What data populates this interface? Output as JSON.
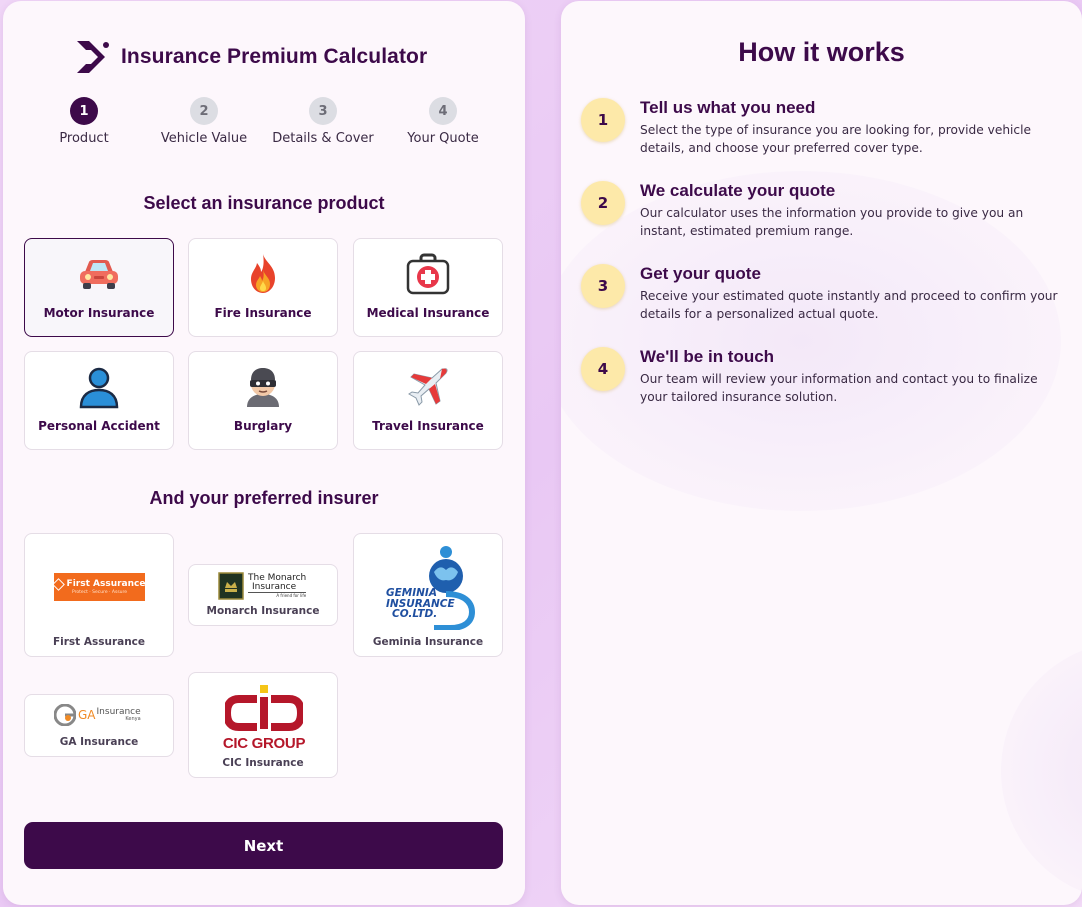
{
  "app": {
    "title": "Insurance Premium Calculator"
  },
  "steps": [
    {
      "number": "1",
      "label": "Product",
      "active": true
    },
    {
      "number": "2",
      "label": "Vehicle Value",
      "active": false
    },
    {
      "number": "3",
      "label": "Details & Cover",
      "active": false
    },
    {
      "number": "4",
      "label": "Your Quote",
      "active": false
    }
  ],
  "products": {
    "title": "Select an insurance product",
    "items": [
      {
        "label": "Motor Insurance",
        "icon": "car-icon",
        "selected": true
      },
      {
        "label": "Fire Insurance",
        "icon": "fire-icon"
      },
      {
        "label": "Medical Insurance",
        "icon": "first-aid-kit-icon"
      },
      {
        "label": "Personal Accident",
        "icon": "person-icon"
      },
      {
        "label": "Burglary",
        "icon": "burglar-icon"
      },
      {
        "label": "Travel Insurance",
        "icon": "airplane-icon"
      }
    ]
  },
  "insurers": {
    "title": "And your preferred insurer",
    "items": [
      {
        "name": "First Assurance",
        "logo_text": "First Assurance",
        "logo_tagline": "Protect · Secure · Assure"
      },
      {
        "name": "Monarch Insurance",
        "logo_text_1": "The Monarch",
        "logo_text_2": "Insurance",
        "logo_tagline": "A friend for life"
      },
      {
        "name": "Geminia Insurance",
        "logo_text_1": "GEMINIA",
        "logo_text_2": "INSURANCE",
        "logo_text_3": "CO.LTD."
      },
      {
        "name": "GA Insurance",
        "logo_text_1": "GA",
        "logo_text_2": "Insurance",
        "logo_text_3": "Kenya"
      },
      {
        "name": "CIC Insurance",
        "logo_text": "CIC GROUP"
      }
    ]
  },
  "next_label": "Next",
  "how_it_works": {
    "title": "How it works",
    "steps": [
      {
        "number": "1",
        "title": "Tell us what you need",
        "body": "Select the type of insurance you are looking for, provide vehicle details, and choose your preferred cover type."
      },
      {
        "number": "2",
        "title": "We calculate your quote",
        "body": "Our calculator uses the information you provide to give you an instant, estimated premium range."
      },
      {
        "number": "3",
        "title": "Get your quote",
        "body": "Receive your estimated quote instantly and proceed to confirm your details for a personalized actual quote."
      },
      {
        "number": "4",
        "title": "We'll be in touch",
        "body": "Our team will review your information and contact you to finalize your tailored insurance solution."
      }
    ]
  },
  "colors": {
    "primary": "#3d0a4a",
    "accent_yellow": "#fde9a9",
    "first_assurance_orange": "#f26b1d",
    "cic_red": "#b5172a"
  }
}
